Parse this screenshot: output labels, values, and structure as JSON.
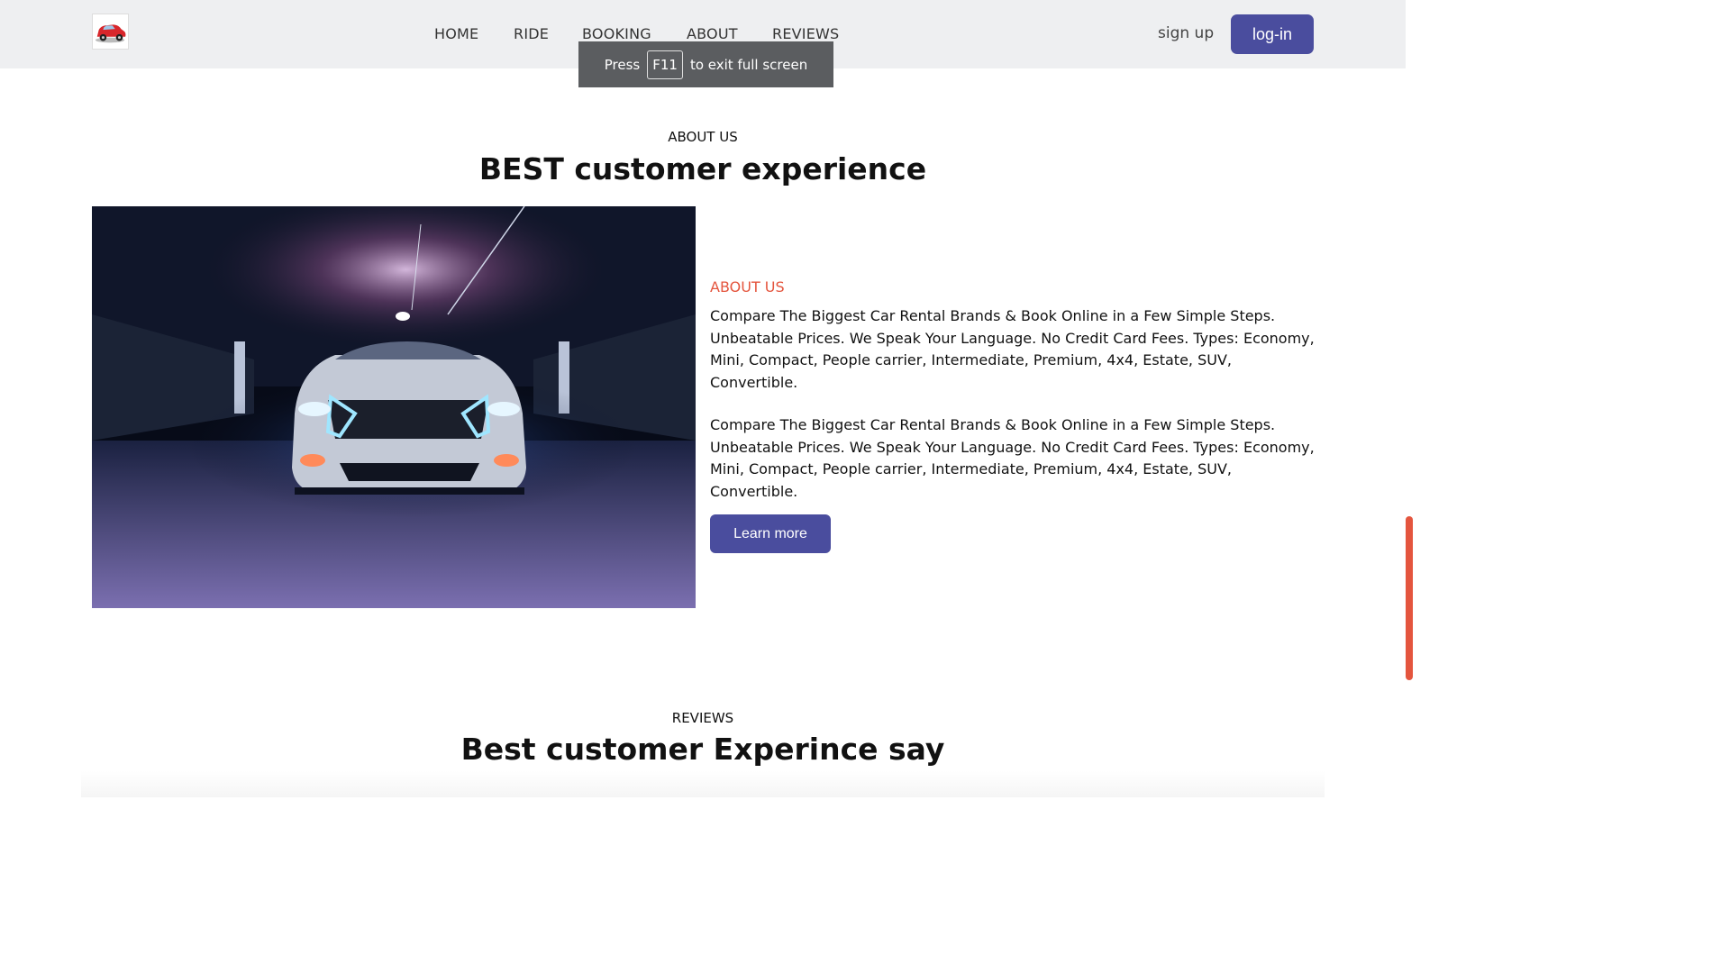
{
  "header": {
    "logo_icon": "car-logo-icon",
    "nav": [
      {
        "label": "HOME"
      },
      {
        "label": "RIDE"
      },
      {
        "label": "BOOKING"
      },
      {
        "label": "ABOUT"
      },
      {
        "label": "REVIEWS"
      }
    ],
    "signup_label": "sign up",
    "login_label": "log-in"
  },
  "fullscreen_toast": {
    "prefix": "Press",
    "key": "F11",
    "suffix": "to exit full screen"
  },
  "about": {
    "kicker": "ABOUT US",
    "heading": "BEST customer experience",
    "image_icon": "car-in-garage-image",
    "label": "ABOUT US",
    "paragraphs": [
      "Compare The Biggest Car Rental Brands & Book Online in a Few Simple Steps. Unbeatable Prices. We Speak Your Language. No Credit Card Fees. Types: Economy, Mini, Compact, People carrier, Intermediate, Premium, 4x4, Estate, SUV, Convertible.",
      "Compare The Biggest Car Rental Brands & Book Online in a Few Simple Steps. Unbeatable Prices. We Speak Your Language. No Credit Card Fees. Types: Economy, Mini, Compact, People carrier, Intermediate, Premium, 4x4, Estate, SUV, Convertible."
    ],
    "button_label": "Learn more"
  },
  "reviews": {
    "kicker": "REVIEWS",
    "heading": "Best customer Experince say"
  },
  "colors": {
    "accent": "#4a4d9e",
    "highlight": "#e4553e",
    "header_bg": "#eeeff1"
  }
}
